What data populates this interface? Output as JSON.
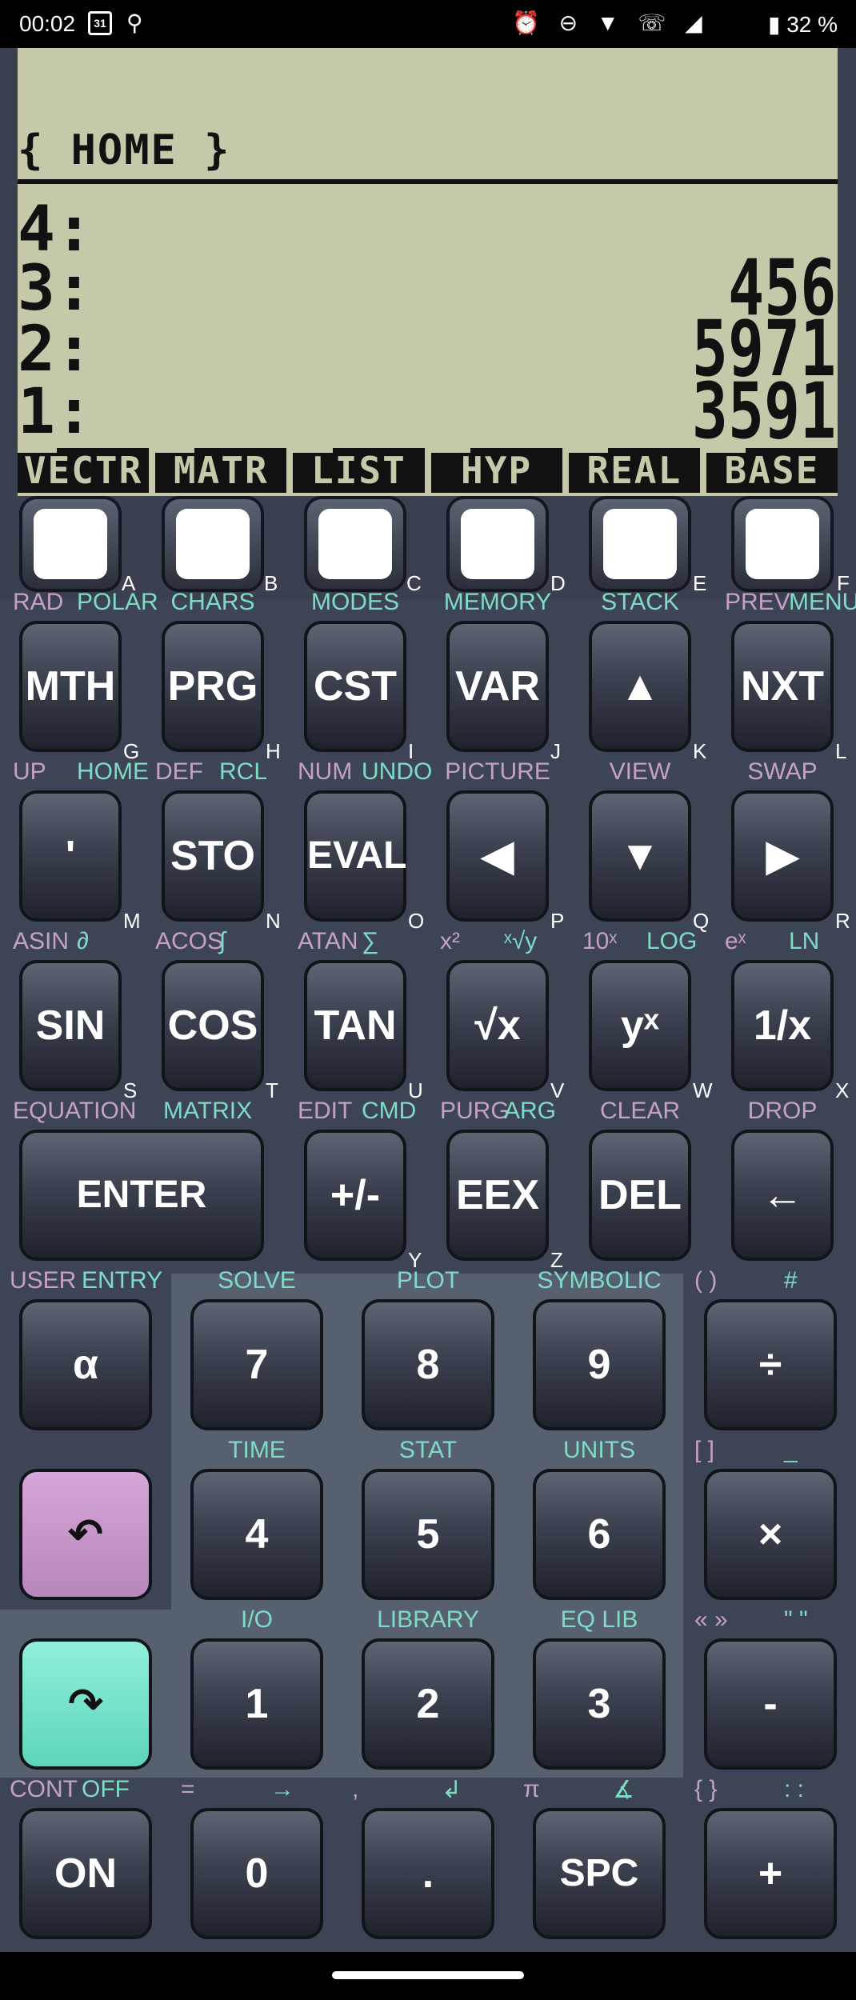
{
  "status": {
    "time": "00:02",
    "calendar_day": "31",
    "icons": "⏰ ⊖ ▼ ☏ ◢",
    "battery": "▮ 32 %"
  },
  "display": {
    "header": "{ HOME }",
    "levels": [
      {
        "n": "4:",
        "v": ""
      },
      {
        "n": "3:",
        "v": "456"
      },
      {
        "n": "2:",
        "v": "5971"
      },
      {
        "n": "1:",
        "v": "3591"
      }
    ],
    "softkeys": [
      "VECTR",
      "MATR",
      "LIST",
      "HYP",
      "REAL",
      "BASE"
    ]
  },
  "menu_letters": [
    "A",
    "B",
    "C",
    "D",
    "E",
    "F"
  ],
  "rows": [
    {
      "keys": [
        {
          "label": "MTH",
          "p": "RAD",
          "g": "POLAR",
          "letter": "G"
        },
        {
          "label": "PRG",
          "p": "",
          "g": "CHARS",
          "letter": "H"
        },
        {
          "label": "CST",
          "p": "",
          "g": "MODES",
          "letter": "I"
        },
        {
          "label": "VAR",
          "p": "",
          "g": "MEMORY",
          "letter": "J"
        },
        {
          "label": "▲",
          "p": "",
          "g": "STACK",
          "letter": "K"
        },
        {
          "label": "NXT",
          "p": "PREV",
          "g": "MENU",
          "letter": "L"
        }
      ]
    },
    {
      "keys": [
        {
          "label": "'",
          "p": "UP",
          "g": "HOME",
          "letter": "M"
        },
        {
          "label": "STO",
          "p": "DEF",
          "g": "RCL",
          "letter": "N"
        },
        {
          "label": "EVAL",
          "p": "NUM",
          "g": "UNDO",
          "letter": "O"
        },
        {
          "label": "◀",
          "p": "PICTURE",
          "g": "",
          "letter": "P"
        },
        {
          "label": "▼",
          "p": "VIEW",
          "g": "",
          "letter": "Q"
        },
        {
          "label": "▶",
          "p": "SWAP",
          "g": "",
          "letter": "R"
        }
      ]
    },
    {
      "keys": [
        {
          "label": "SIN",
          "p": "ASIN",
          "g": "∂",
          "letter": "S"
        },
        {
          "label": "COS",
          "p": "ACOS",
          "g": "∫",
          "letter": "T"
        },
        {
          "label": "TAN",
          "p": "ATAN",
          "g": "∑",
          "letter": "U"
        },
        {
          "label": "√x",
          "p": "x²",
          "g": "ˣ√y",
          "letter": "V"
        },
        {
          "label": "yˣ",
          "p": "10ˣ",
          "g": "LOG",
          "letter": "W"
        },
        {
          "label": "1/x",
          "p": "eˣ",
          "g": "LN",
          "letter": "X"
        }
      ]
    },
    {
      "keys": [
        {
          "label": "ENTER",
          "p": "EQUATION",
          "g": "MATRIX",
          "letter": ""
        },
        {
          "label": "+/-",
          "p": "EDIT",
          "g": "CMD",
          "letter": "Y"
        },
        {
          "label": "EEX",
          "p": "PURG",
          "g": "ARG",
          "letter": "Z"
        },
        {
          "label": "DEL",
          "p": "CLEAR",
          "g": "",
          "letter": ""
        },
        {
          "label": "←",
          "p": "DROP",
          "g": "",
          "letter": ""
        }
      ]
    }
  ],
  "numrows": [
    {
      "keys": [
        {
          "label": "α",
          "p": "USER",
          "g": "ENTRY"
        },
        {
          "label": "7",
          "p": "",
          "g": "SOLVE"
        },
        {
          "label": "8",
          "p": "",
          "g": "PLOT"
        },
        {
          "label": "9",
          "p": "",
          "g": "SYMBOLIC"
        },
        {
          "label": "÷",
          "p": "( )",
          "g": "#"
        }
      ]
    },
    {
      "keys": [
        {
          "label": "↶",
          "p": "",
          "g": ""
        },
        {
          "label": "4",
          "p": "",
          "g": "TIME"
        },
        {
          "label": "5",
          "p": "",
          "g": "STAT"
        },
        {
          "label": "6",
          "p": "",
          "g": "UNITS"
        },
        {
          "label": "×",
          "p": "[ ]",
          "g": "_"
        }
      ]
    },
    {
      "keys": [
        {
          "label": "↷",
          "p": "",
          "g": ""
        },
        {
          "label": "1",
          "p": "",
          "g": "I/O"
        },
        {
          "label": "2",
          "p": "",
          "g": "LIBRARY"
        },
        {
          "label": "3",
          "p": "",
          "g": "EQ LIB"
        },
        {
          "label": "-",
          "p": "« »",
          "g": "\" \""
        }
      ]
    },
    {
      "keys": [
        {
          "label": "ON",
          "p": "CONT",
          "g": "OFF"
        },
        {
          "label": "0",
          "p": "=",
          "g": "→"
        },
        {
          "label": ".",
          "p": ",",
          "g": "↲"
        },
        {
          "label": "SPC",
          "p": "π",
          "g": "∡"
        },
        {
          "label": "+",
          "p": "{ }",
          "g": ": :"
        }
      ]
    }
  ]
}
